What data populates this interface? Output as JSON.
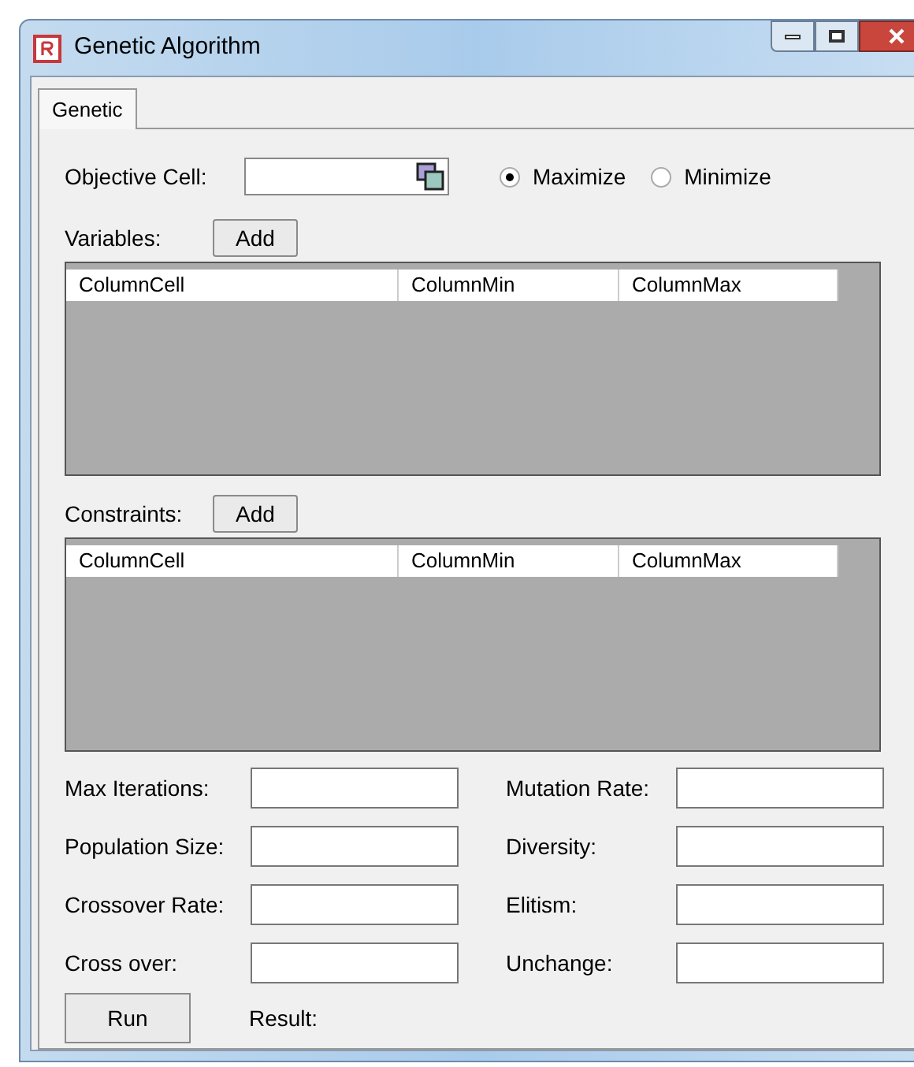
{
  "window": {
    "title": "Genetic Algorithm"
  },
  "tabs": [
    {
      "label": "Genetic",
      "selected": true
    }
  ],
  "objective": {
    "label": "Objective Cell:",
    "options": [
      {
        "label": "Maximize",
        "selected": true
      },
      {
        "label": "Minimize",
        "selected": false
      }
    ]
  },
  "grids": [
    {
      "label": "Variables:",
      "button": "Add",
      "columns": [
        "ColumnCell",
        "ColumnMin",
        "ColumnMax"
      ]
    },
    {
      "label": "Constraints:",
      "button": "Add",
      "columns": [
        "ColumnCell",
        "ColumnMin",
        "ColumnMax"
      ]
    }
  ],
  "fields": [
    {
      "label": "Max Iterations:"
    },
    {
      "label": "Mutation Rate:"
    },
    {
      "label": "Population Size:"
    },
    {
      "label": "Diversity:"
    },
    {
      "label": "Crossover Rate:"
    },
    {
      "label": "Elitism:"
    },
    {
      "label": "Cross over:"
    },
    {
      "label": "Unchange:"
    }
  ],
  "run_button": "Run",
  "result_label": "Result:"
}
